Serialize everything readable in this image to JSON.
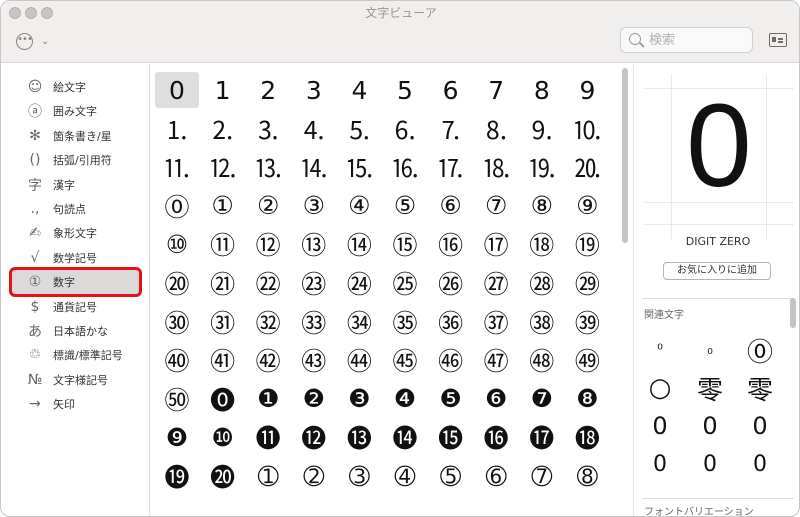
{
  "window": {
    "title": "文字ビューア"
  },
  "toolbar": {
    "more_icon": "ellipsis-circle-icon",
    "chevron_icon": "chevron-down-icon",
    "search_placeholder": "検索",
    "card_icon": "character-info-icon"
  },
  "sidebar": {
    "categories": [
      {
        "glyph": "☺",
        "label": "絵文字",
        "icon": "smiley-icon"
      },
      {
        "glyph": "ⓐ",
        "label": "囲み文字",
        "icon": "circled-a-icon"
      },
      {
        "glyph": "✻",
        "label": "箇条書き/星",
        "icon": "asterisk-icon"
      },
      {
        "glyph": "()",
        "label": "括弧/引用符",
        "icon": "parentheses-icon"
      },
      {
        "glyph": "字",
        "label": "漢字",
        "icon": "kanji-icon"
      },
      {
        "glyph": ".,",
        "label": "句読点",
        "icon": "punctuation-icon"
      },
      {
        "glyph": "✍",
        "label": "象形文字",
        "icon": "pictograph-icon"
      },
      {
        "glyph": "√",
        "label": "数学記号",
        "icon": "square-root-icon"
      },
      {
        "glyph": "①",
        "label": "数字",
        "icon": "circled-one-icon",
        "selected": true
      },
      {
        "glyph": "$",
        "label": "通貨記号",
        "icon": "dollar-icon"
      },
      {
        "glyph": "あ",
        "label": "日本語かな",
        "icon": "hiragana-icon"
      },
      {
        "glyph": "♲",
        "label": "標識/標準記号",
        "icon": "recycle-icon"
      },
      {
        "glyph": "№",
        "label": "文字様記号",
        "icon": "numero-icon"
      },
      {
        "glyph": "→",
        "label": "矢印",
        "icon": "arrow-icon"
      }
    ]
  },
  "grid": {
    "selected_index": 0,
    "rows": [
      [
        "0",
        "1",
        "2",
        "3",
        "4",
        "5",
        "6",
        "7",
        "8",
        "9"
      ],
      [
        "⒈",
        "⒉",
        "⒊",
        "⒋",
        "⒌",
        "⒍",
        "⒎",
        "⒏",
        "⒐",
        "⒑"
      ],
      [
        "⒒",
        "⒓",
        "⒔",
        "⒕",
        "⒖",
        "⒗",
        "⒘",
        "⒙",
        "⒚",
        "⒛"
      ],
      [
        "⓪",
        "①",
        "②",
        "③",
        "④",
        "⑤",
        "⑥",
        "⑦",
        "⑧",
        "⑨"
      ],
      [
        "⑩",
        "⑪",
        "⑫",
        "⑬",
        "⑭",
        "⑮",
        "⑯",
        "⑰",
        "⑱",
        "⑲"
      ],
      [
        "⑳",
        "㉑",
        "㉒",
        "㉓",
        "㉔",
        "㉕",
        "㉖",
        "㉗",
        "㉘",
        "㉙"
      ],
      [
        "㉚",
        "㉛",
        "㉜",
        "㉝",
        "㉞",
        "㉟",
        "㊱",
        "㊲",
        "㊳",
        "㊴"
      ],
      [
        "㊵",
        "㊶",
        "㊷",
        "㊸",
        "㊹",
        "㊺",
        "㊻",
        "㊼",
        "㊽",
        "㊾"
      ],
      [
        "㊿",
        "⓿",
        "❶",
        "❷",
        "❸",
        "❹",
        "❺",
        "❻",
        "❼",
        "❽"
      ],
      [
        "❾",
        "❿",
        "⓫",
        "⓬",
        "⓭",
        "⓮",
        "⓯",
        "⓰",
        "⓱",
        "⓲"
      ],
      [
        "⓳",
        "⓴",
        "➀",
        "➁",
        "➂",
        "➃",
        "➄",
        "➅",
        "➆",
        "➇"
      ]
    ]
  },
  "detail": {
    "character": "0",
    "name": "DIGIT ZERO",
    "favorite_button": "お気に入りに追加",
    "related_title": "関連文字",
    "related": [
      {
        "char": "⁰",
        "size": 14
      },
      {
        "char": "₀",
        "size": 14
      },
      {
        "char": "⓪",
        "size": 26
      },
      {
        "char": "○",
        "size": 26
      },
      {
        "char": "零",
        "size": 26
      },
      {
        "char": "零",
        "size": 26
      },
      {
        "char": "0",
        "size": 24
      },
      {
        "char": "0",
        "size": 24
      },
      {
        "char": "0",
        "size": 24
      },
      {
        "char": "0",
        "size": 22
      },
      {
        "char": "0",
        "size": 22
      },
      {
        "char": "0",
        "size": 22
      }
    ],
    "font_variation_title": "フォントバリエーション"
  }
}
